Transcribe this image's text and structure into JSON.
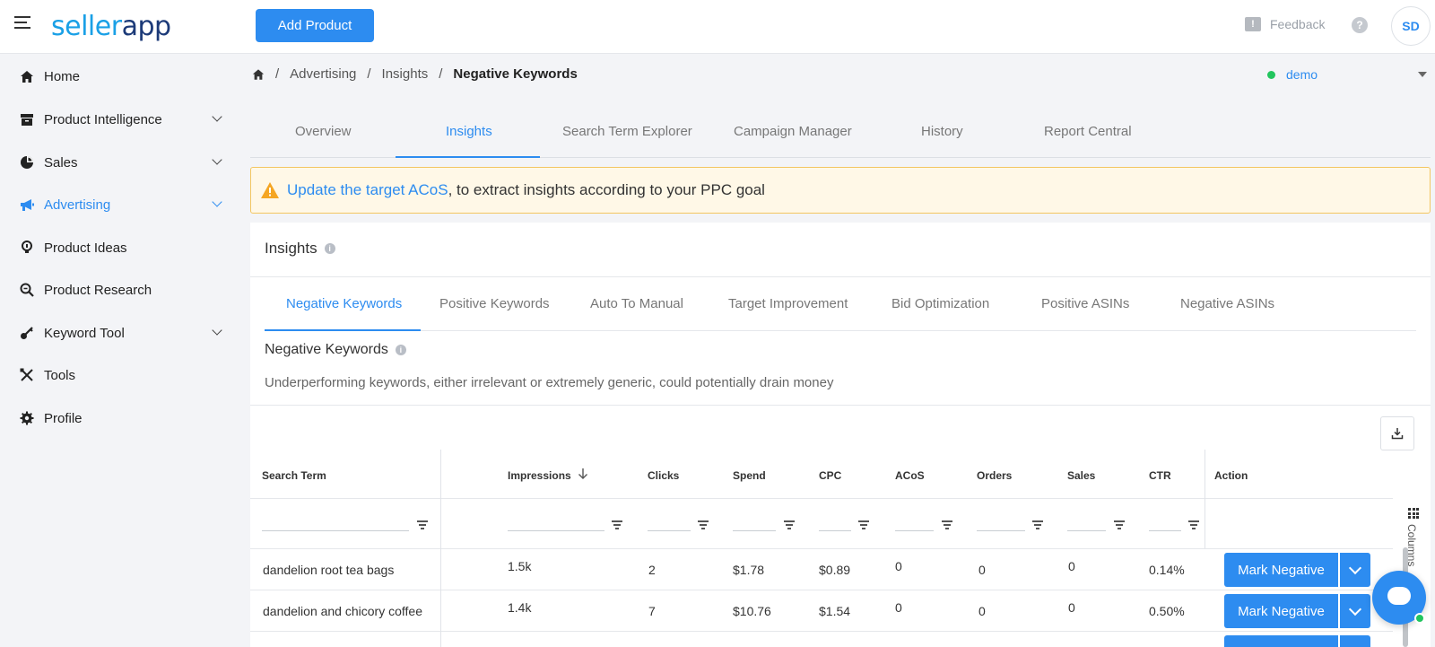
{
  "header": {
    "logo_part1": "seller",
    "logo_part2": "app",
    "add_product": "Add Product",
    "feedback": "Feedback",
    "help": "?",
    "avatar": "SD"
  },
  "sidebar": {
    "items": [
      {
        "label": "Home",
        "icon": "home-icon"
      },
      {
        "label": "Product Intelligence",
        "icon": "archive-icon"
      },
      {
        "label": "Sales",
        "icon": "pie-chart-icon"
      },
      {
        "label": "Advertising",
        "icon": "megaphone-icon"
      },
      {
        "label": "Product Ideas",
        "icon": "lightbulb-icon"
      },
      {
        "label": "Product Research",
        "icon": "magnify-icon"
      },
      {
        "label": "Keyword Tool",
        "icon": "key-icon"
      },
      {
        "label": "Tools",
        "icon": "tools-icon"
      },
      {
        "label": "Profile",
        "icon": "gear-icon"
      }
    ]
  },
  "breadcrumb": {
    "items": [
      "Advertising",
      "Insights"
    ],
    "current": "Negative Keywords",
    "sep": "/"
  },
  "account": {
    "name": "demo"
  },
  "main_tabs": [
    "Overview",
    "Insights",
    "Search Term Explorer",
    "Campaign Manager",
    "History",
    "Report Central"
  ],
  "alert": {
    "link": "Update the target ACoS",
    "text": ", to extract insights according to your PPC goal"
  },
  "insights": {
    "title": "Insights",
    "sub_tabs": [
      "Negative Keywords",
      "Positive Keywords",
      "Auto To Manual",
      "Target Improvement",
      "Bid Optimization",
      "Positive ASINs",
      "Negative ASINs"
    ],
    "section_title": "Negative Keywords",
    "section_desc": "Underperforming keywords, either irrelevant or extremely generic, could potentially drain money"
  },
  "table": {
    "columns": [
      "Search Term",
      "Impressions",
      "Clicks",
      "Spend",
      "CPC",
      "ACoS",
      "Orders",
      "Sales",
      "CTR",
      "Action"
    ],
    "rows": [
      {
        "term": "dandelion root tea bags",
        "impressions": "1.5k",
        "clicks": "2",
        "spend": "$1.78",
        "cpc": "$0.89",
        "acos": "0",
        "orders": "0",
        "sales": "0",
        "ctr": "0.14%",
        "action": "Mark Negative"
      },
      {
        "term": "dandelion and chicory coffee",
        "impressions": "1.4k",
        "clicks": "7",
        "spend": "$10.76",
        "cpc": "$1.54",
        "acos": "0",
        "orders": "0",
        "sales": "0",
        "ctr": "0.50%",
        "action": "Mark Negative"
      }
    ]
  },
  "columns_panel": {
    "label": "Columns"
  }
}
